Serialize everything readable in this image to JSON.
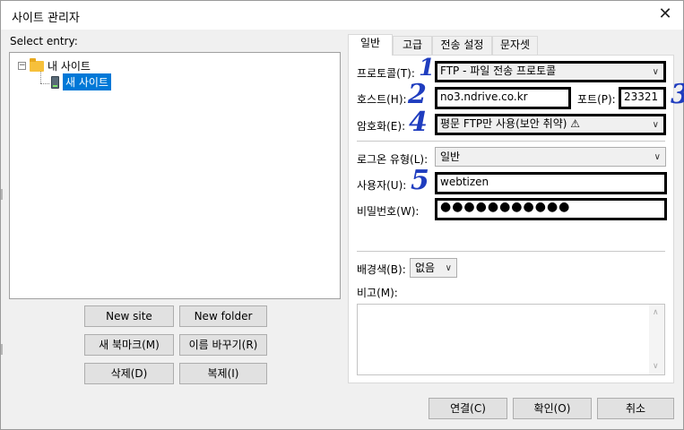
{
  "window": {
    "title": "사이트 관리자",
    "close_glyph": "✕"
  },
  "left": {
    "select_entry_label": "Select entry:",
    "tree": {
      "root_label": "내 사이트",
      "root_expander": "−",
      "child_label": "새 사이트"
    },
    "buttons": {
      "new_site": "New site",
      "new_folder": "New folder",
      "new_bookmark": "새 북마크(M)",
      "rename": "이름 바꾸기(R)",
      "delete": "삭제(D)",
      "duplicate": "복제(I)"
    }
  },
  "tabs": [
    {
      "label": "일반",
      "active": true
    },
    {
      "label": "고급"
    },
    {
      "label": "전송 설정"
    },
    {
      "label": "문자셋"
    }
  ],
  "general": {
    "protocol_label": "프로토콜(T):",
    "protocol_value": "FTP - 파일 전송 프로토콜",
    "host_label": "호스트(H):",
    "host_value": "no3.ndrive.co.kr",
    "port_label": "포트(P):",
    "port_value": "23321",
    "encryption_label": "암호화(E):",
    "encryption_value": "평문 FTP만 사용(보안 취약) ⚠",
    "logon_type_label": "로그온 유형(L):",
    "logon_type_value": "일반",
    "user_label": "사용자(U):",
    "user_value": "webtizen",
    "password_label": "비밀번호(W):",
    "password_value": "●●●●●●●●●●●",
    "background_label": "배경색(B):",
    "background_value": "없음",
    "comments_label": "비고(M):"
  },
  "annotations": [
    "1",
    "2",
    "3",
    "4",
    "5"
  ],
  "footer": {
    "connect": "연결(C)",
    "ok": "확인(O)",
    "cancel": "취소"
  },
  "colors": {
    "selection": "#0078d7",
    "annotation_ink": "#1f3dbf"
  }
}
